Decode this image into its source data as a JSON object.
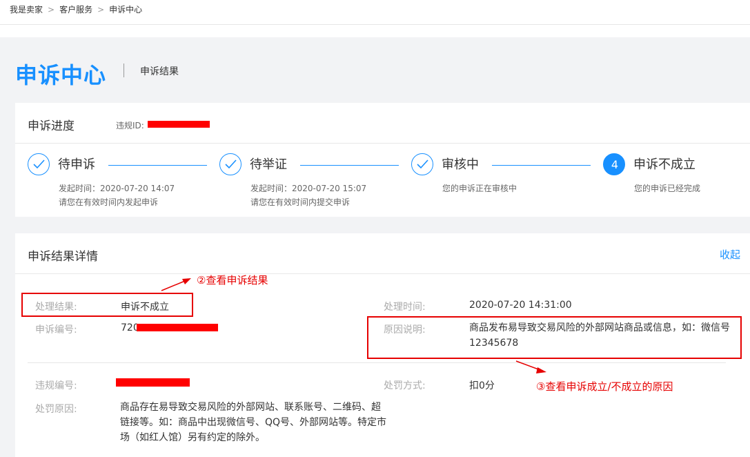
{
  "breadcrumb": {
    "items": [
      "我是卖家",
      "客户服务",
      "申诉中心"
    ],
    "separator": ">"
  },
  "header": {
    "title": "申诉中心",
    "subtitle": "申诉结果"
  },
  "progress": {
    "title": "申诉进度",
    "violation_id_label": "违规ID:",
    "steps": [
      {
        "name": "待申诉",
        "line1": "发起时间：2020-07-20 14:07",
        "line2": "请您在有效时间内发起申诉",
        "status": "done"
      },
      {
        "name": "待举证",
        "line1": "发起时间：2020-07-20 15:07",
        "line2": "请您在有效时间内提交申诉",
        "status": "done"
      },
      {
        "name": "审核中",
        "line1": "您的申诉正在审核中",
        "status": "done"
      },
      {
        "name": "申诉不成立",
        "number": "4",
        "line1": "您的申诉已经完成",
        "status": "current"
      }
    ]
  },
  "details": {
    "title": "申诉结果详情",
    "collapse": "收起",
    "result_label": "处理结果:",
    "result_value": "申诉不成立",
    "time_label": "处理时间:",
    "time_value": "2020-07-20 14:31:00",
    "appeal_no_label": "申诉编号:",
    "appeal_no_prefix": "720",
    "reason_label": "原因说明:",
    "reason_value": "商品发布易导致交易风险的外部网站商品或信息，如：微信号12345678",
    "violation_no_label": "违规编号:",
    "penalty_label": "处罚方式:",
    "penalty_value": "扣0分",
    "penalty_reason_label": "处罚原因:",
    "penalty_reason_value": "商品存在易导致交易风险的外部网站、联系账号、二维码、超链接等。如：商品中出现微信号、QQ号、外部网站等。特定市场（如红人馆）另有约定的除外。"
  },
  "annotations": {
    "note1": "②查看申诉结果",
    "note2": "③查看申诉成立/不成立的原因"
  },
  "colors": {
    "accent": "#1890ff",
    "annotation": "#e60000",
    "redaction": "#ff0000",
    "page_bg": "#f2f3f5"
  }
}
